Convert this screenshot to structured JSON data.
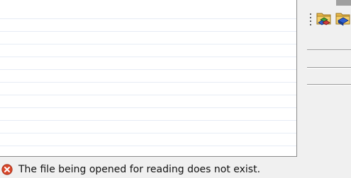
{
  "status": {
    "icon": "error-icon",
    "message": "The file being opened for reading does not exist."
  },
  "toolbar": {
    "icons": [
      "folder-shapes-icon",
      "folder-shapes-icon"
    ]
  },
  "colors": {
    "list_background": "#ffffff",
    "row_line": "#e6ecf5",
    "error_red": "#d9482b",
    "window_background": "#f0f0f0"
  }
}
